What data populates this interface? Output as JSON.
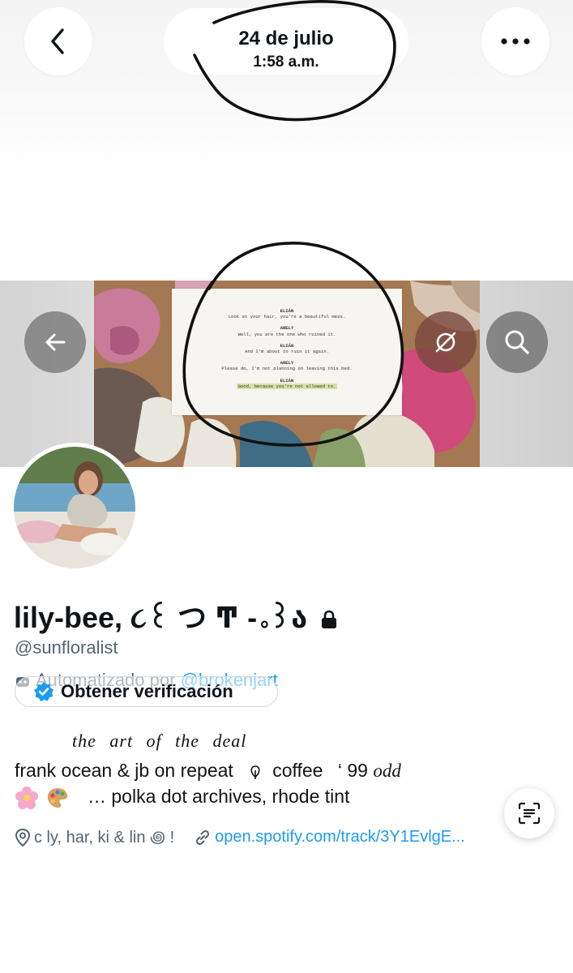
{
  "header": {
    "date": "24 de julio",
    "time": "1:58 a.m.",
    "back_icon": "chevron-left-icon",
    "more_icon": "ellipsis-icon"
  },
  "banner": {
    "script_lines": [
      {
        "speaker": "ELIÁN",
        "line": "Look at your hair, you're a beautiful mess."
      },
      {
        "speaker": "ARELY",
        "line": "Well, you are the one who ruined it."
      },
      {
        "speaker": "ELIÁN",
        "line": "And I'm about to ruin it again."
      },
      {
        "speaker": "ARELY",
        "line": "Please do, I'm not planning on leaving this bed."
      },
      {
        "speaker": "ELIÁN",
        "line": "Good, because you're not allowed to."
      }
    ],
    "buttons": [
      "arrow-left-icon",
      "download-disabled-icon",
      "search-icon"
    ]
  },
  "profile": {
    "display_name": "lily-bee, ૮꒰ つ ͳ -｡꒱ა",
    "handle": "@sunfloralist",
    "automated_prefix": "Automatizado por",
    "automated_by": "@brokenjart",
    "verify_label": "Obtener verificación",
    "bio_title": "the art of the deal",
    "bio_line1_a": "frank ocean & jb on repeat",
    "bio_line1_b": "coffee",
    "bio_line1_c": "‘ 99",
    "bio_line1_d": "odd",
    "bio_line2": "…   polka dot archives,   rhode tint",
    "location": "c   ly,  har,  ki  &  lin   ꩜ !",
    "website": "open.spotify.com/track/3Y1EvlgE..."
  },
  "colors": {
    "link": "#1d9bf0",
    "secondary_text": "#536471",
    "primary_text": "#0f1419",
    "annotation_ink": "#111111"
  }
}
